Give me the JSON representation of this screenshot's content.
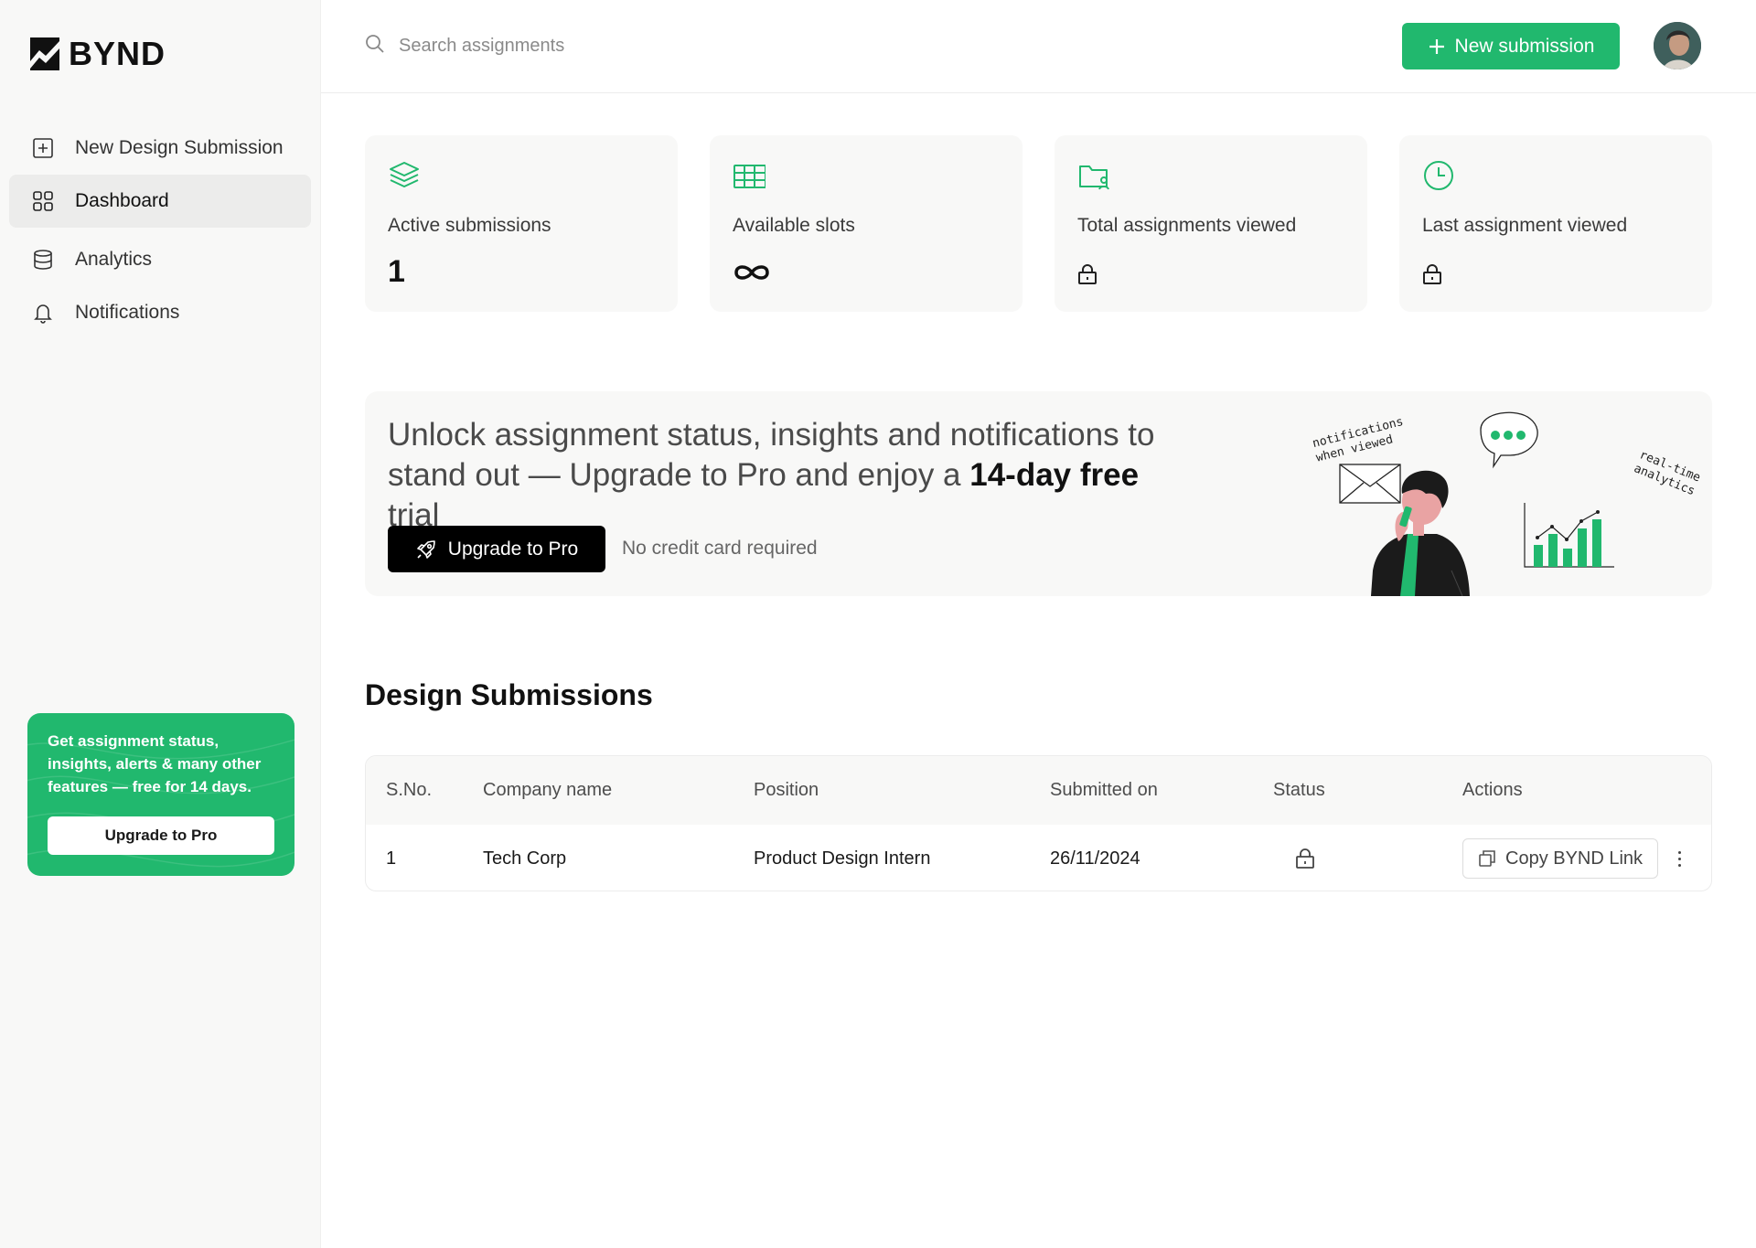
{
  "brand": {
    "name": "BYND"
  },
  "sidebar": {
    "items": [
      {
        "label": "New Design Submission",
        "icon": "plus-square-icon"
      },
      {
        "label": "Dashboard",
        "icon": "grid-icon",
        "active": true
      },
      {
        "label": "Analytics",
        "icon": "database-icon"
      },
      {
        "label": "Notifications",
        "icon": "bell-icon"
      }
    ],
    "promo": {
      "text": "Get assignment status, insights, alerts & many other features — free for 14 days.",
      "button": "Upgrade to Pro"
    }
  },
  "topbar": {
    "search_placeholder": "Search assignments",
    "new_submission": "New submission"
  },
  "stats": [
    {
      "label": "Active submissions",
      "value": "1",
      "icon": "layers-icon"
    },
    {
      "label": "Available slots",
      "value": "∞",
      "icon": "table-icon"
    },
    {
      "label": "Total assignments viewed",
      "value": "locked",
      "icon": "folder-user-icon"
    },
    {
      "label": "Last assignment viewed",
      "value": "locked",
      "icon": "clock-icon"
    }
  ],
  "banner": {
    "title_part1": "Unlock assignment status, insights and notifications to stand out — Upgrade to Pro and enjoy a ",
    "title_bold": "14-day free",
    "title_part2": " trial",
    "button": "Upgrade to Pro",
    "note": "No credit card required",
    "annotation_left": "notifications when viewed",
    "annotation_right": "real-time analytics"
  },
  "submissions": {
    "title": "Design Submissions",
    "columns": [
      "S.No.",
      "Company name",
      "Position",
      "Submitted on",
      "Status",
      "Actions"
    ],
    "rows": [
      {
        "sno": "1",
        "company": "Tech Corp",
        "position": "Product Design Intern",
        "submitted": "26/11/2024",
        "status": "locked",
        "action": "Copy BYND Link"
      }
    ]
  },
  "colors": {
    "accent": "#21b86e",
    "sidebar_bg": "#f8f8f7",
    "dark": "#000000"
  }
}
